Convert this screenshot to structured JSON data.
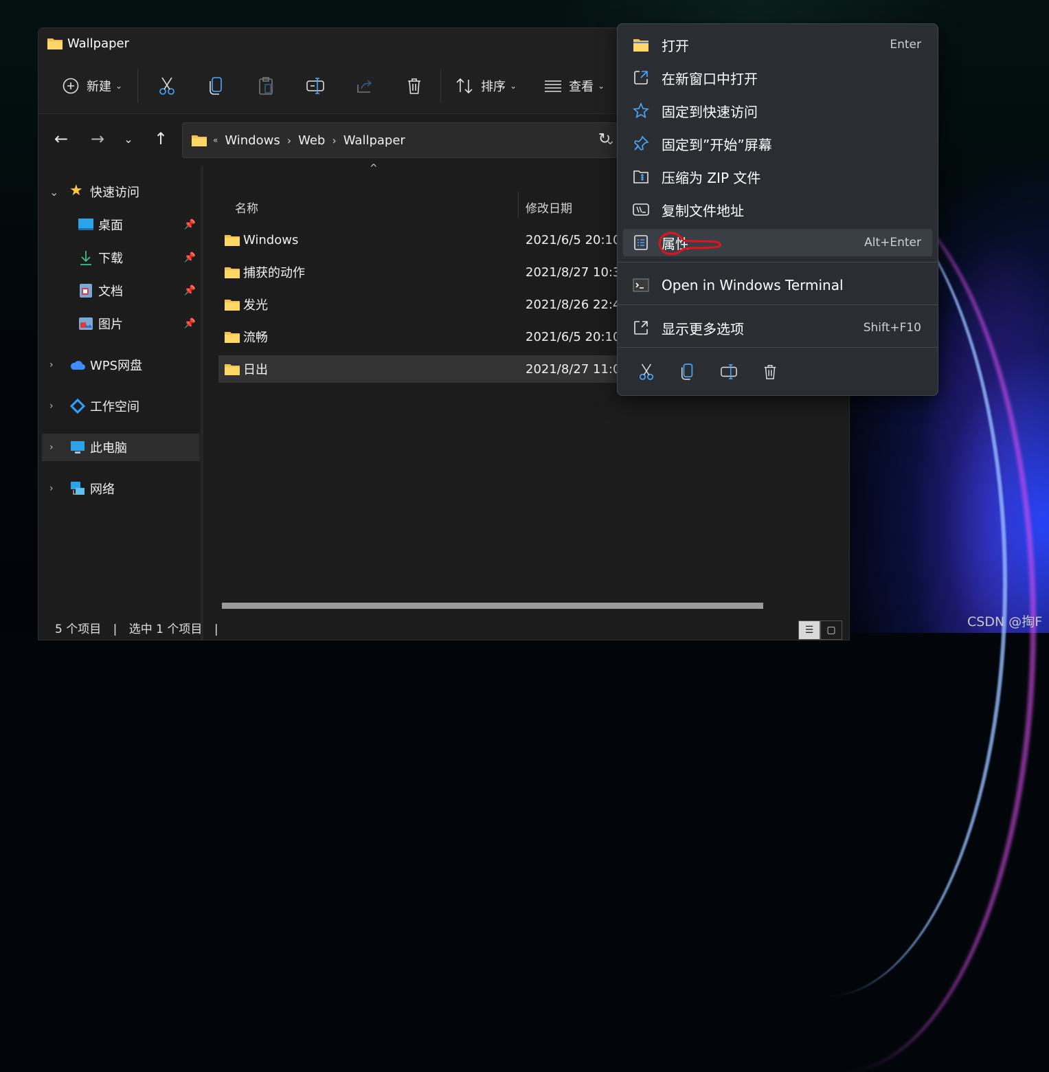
{
  "window": {
    "title": "Wallpaper"
  },
  "toolbar": {
    "new_label": "新建",
    "sort_label": "排序",
    "view_label": "查看"
  },
  "breadcrumb": {
    "items": [
      "Windows",
      "Web",
      "Wallpaper"
    ]
  },
  "sidebar": {
    "quick_access": "快速访问",
    "pinned": [
      {
        "label": "桌面",
        "icon": "desktop-icon"
      },
      {
        "label": "下载",
        "icon": "download-icon"
      },
      {
        "label": "文档",
        "icon": "documents-icon"
      },
      {
        "label": "图片",
        "icon": "pictures-icon"
      }
    ],
    "wps": "WPS网盘",
    "workspace": "工作空间",
    "this_pc": "此电脑",
    "network": "网络"
  },
  "columns": {
    "name": "名称",
    "modified": "修改日期"
  },
  "files": [
    {
      "name": "Windows",
      "date": "2021/6/5 20:10"
    },
    {
      "name": "捕获的动作",
      "date": "2021/8/27 10:3"
    },
    {
      "name": "发光",
      "date": "2021/8/26 22:4"
    },
    {
      "name": "流畅",
      "date": "2021/6/5 20:10"
    },
    {
      "name": "日出",
      "date": "2021/8/27 11:0",
      "selected": true
    }
  ],
  "status": {
    "count": "5 个项目",
    "selected": "选中 1 个项目"
  },
  "context_menu": {
    "items": [
      {
        "label": "打开",
        "shortcut": "Enter",
        "icon": "folder-open-icon"
      },
      {
        "label": "在新窗口中打开",
        "shortcut": "",
        "icon": "new-window-icon"
      },
      {
        "label": "固定到快速访问",
        "shortcut": "",
        "icon": "star-icon"
      },
      {
        "label": "固定到”开始”屏幕",
        "shortcut": "",
        "icon": "pin-icon"
      },
      {
        "label": "压缩为 ZIP 文件",
        "shortcut": "",
        "icon": "zip-icon"
      },
      {
        "label": "复制文件地址",
        "shortcut": "",
        "icon": "copy-path-icon"
      },
      {
        "label": "属性",
        "shortcut": "Alt+Enter",
        "icon": "properties-icon",
        "hovered": true
      },
      {
        "label": "Open in Windows Terminal",
        "shortcut": "",
        "icon": "terminal-icon"
      },
      {
        "label": "显示更多选项",
        "shortcut": "Shift+F10",
        "icon": "more-options-icon"
      }
    ]
  },
  "watermark": "CSDN @掏F",
  "colors": {
    "accent": "#4aa8ff",
    "folder": "#f2c14e",
    "annotation": "#e0141e"
  }
}
